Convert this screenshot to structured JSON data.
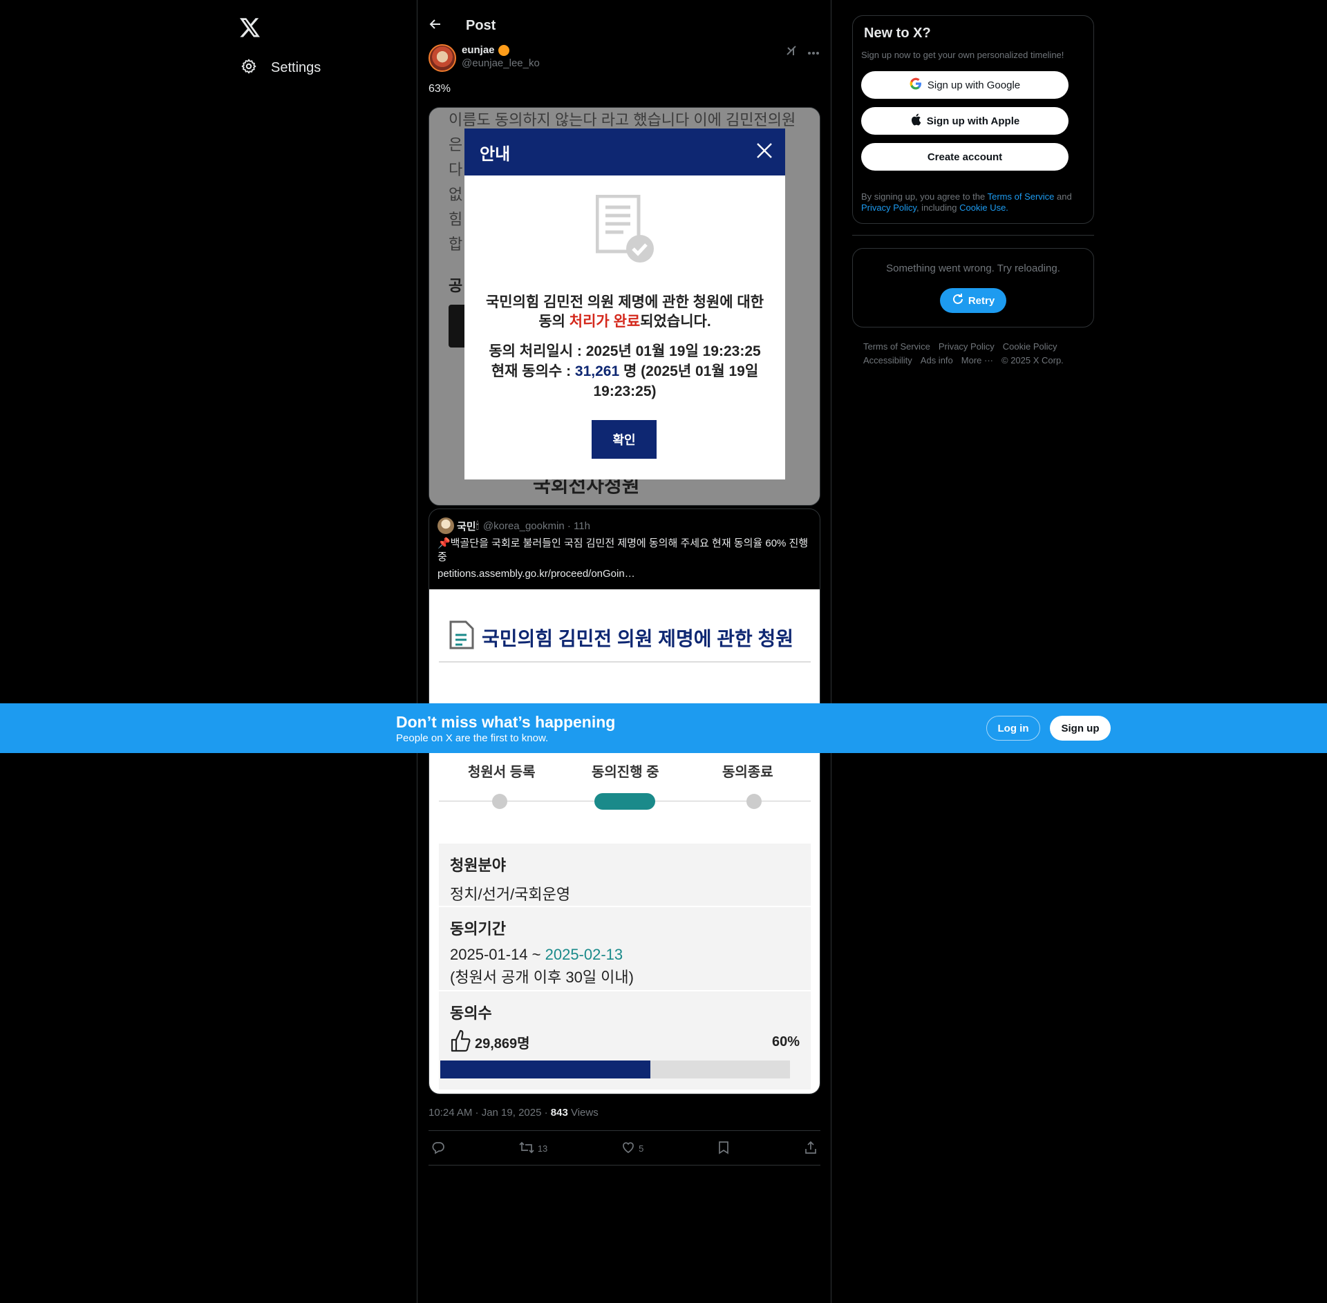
{
  "nav": {
    "settings_label": "Settings"
  },
  "post_header": {
    "title": "Post"
  },
  "author": {
    "name": "eunjae",
    "handle": "@eunjae_lee_ko"
  },
  "post": {
    "text": "63%",
    "timestamp": "10:24 AM · Jan 19, 2025 · ",
    "views_count": "843",
    "views_label": " Views",
    "retweets": "13",
    "likes": "5"
  },
  "media1": {
    "bg_lines": [
      "이름도 동의하지 않는다 라고 했습니다 이에 김민전의원",
      "은",
      "다",
      "없",
      "힘",
      "합"
    ],
    "bg_label": "공",
    "foot_text": "국회전자청원",
    "modal": {
      "title": "안내",
      "message_part1": "국민의힘 김민전 의원 제명에 관한 청원에 대한 동의 ",
      "message_highlight": "처리가 완료",
      "message_part2": "되었습니다.",
      "detail_line1": "동의 처리일시 : 2025년 01월 19일 19:23:25",
      "detail_count_prefix": "현재 동의수 : ",
      "detail_count": "31,261",
      "detail_count_suffix": " 명 (2025년 01월 19일 19:23:25)",
      "confirm_label": "확인"
    }
  },
  "quote": {
    "name": "국민",
    "emoji": "🕯",
    "handle": "@korea_gookmin · 11h",
    "text": "📌백골단을 국회로 불러들인 국짐 김민전 제명에 동의해 주세요 현재 동의율 60% 진행 중",
    "link": "petitions.assembly.go.kr/proceed/onGoin…",
    "image": {
      "title": "국민의힘 김민전 의원 제명에 관한 청원",
      "steps": [
        "청원서 등록",
        "동의진행 중",
        "동의종료"
      ],
      "field_label": "청원분야",
      "field_value": "정치/선거/국회운영",
      "period_label": "동의기간",
      "period_start": "2025-01-14 ~ ",
      "period_end": "2025-02-13",
      "period_note": "(청원서 공개 이후 30일 이내)",
      "count_label": "동의수",
      "count_value": "29,869명",
      "percent": "60%",
      "progress_fraction": 0.6
    }
  },
  "sidebar": {
    "new_title": "New to X?",
    "new_sub": "Sign up now to get your own personalized timeline!",
    "google_label": "Sign up with Google",
    "apple_label": "Sign up with Apple",
    "create_label": "Create account",
    "legal_prefix": "By signing up, you agree to the ",
    "terms_link": "Terms of Service",
    "legal_and": " and ",
    "privacy_link": "Privacy Policy",
    "legal_including": ", including ",
    "cookie_link": "Cookie Use.",
    "error_msg": "Something went wrong. Try reloading.",
    "retry_label": "Retry",
    "footer": [
      "Terms of Service",
      "Privacy Policy",
      "Cookie Policy",
      "Accessibility",
      "Ads info",
      "More ···",
      "© 2025 X Corp."
    ]
  },
  "banner": {
    "title": "Don’t miss what’s happening",
    "subtitle": "People on X are the first to know.",
    "login_label": "Log in",
    "signup_label": "Sign up"
  },
  "colors": {
    "x_blue": "#1d9bf0",
    "petition_navy": "#0e2772",
    "petition_teal": "#1a8a8a",
    "alert_red": "#d4281c"
  }
}
